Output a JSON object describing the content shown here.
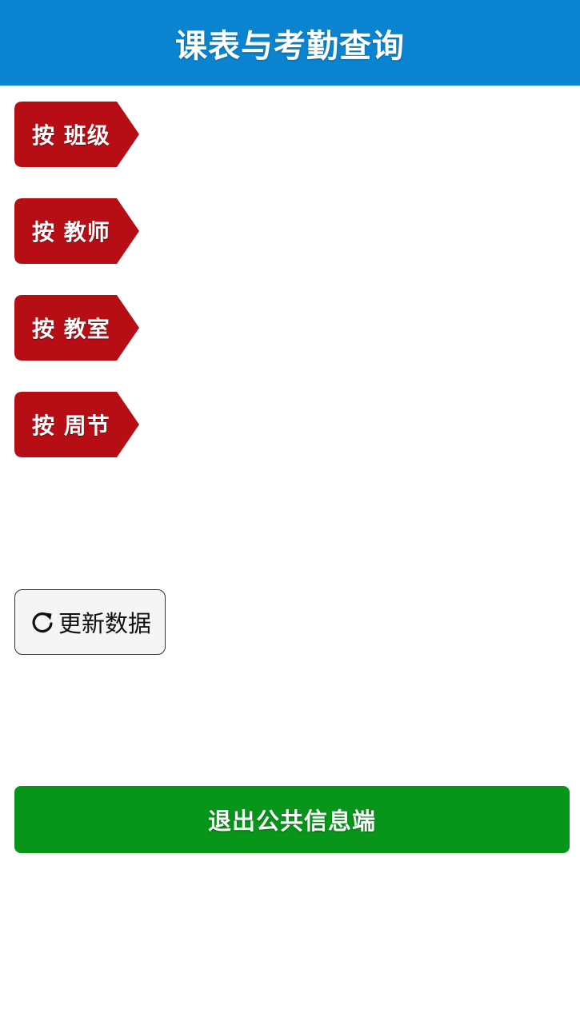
{
  "header": {
    "title": "课表与考勤查询"
  },
  "query_buttons": [
    {
      "label": "按 班级"
    },
    {
      "label": "按 教师"
    },
    {
      "label": "按 教室"
    },
    {
      "label": "按 周节"
    }
  ],
  "refresh": {
    "label": "更新数据",
    "icon": "refresh-icon"
  },
  "exit": {
    "label": "退出公共信息端"
  },
  "colors": {
    "header_bg": "#0a84d0",
    "query_button_bg": "#b70d14",
    "exit_button_bg": "#07951a"
  }
}
